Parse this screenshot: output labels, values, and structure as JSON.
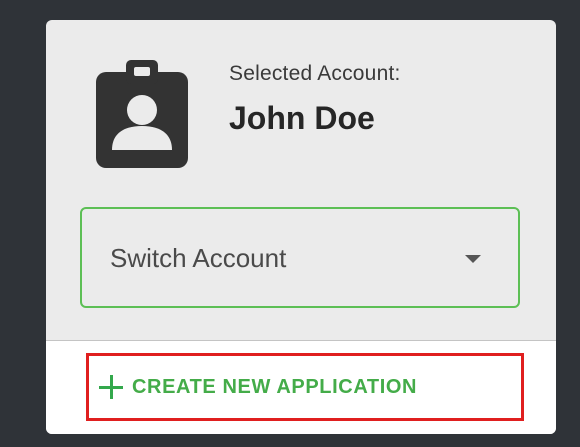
{
  "account": {
    "selected_label": "Selected Account:",
    "name": "John Doe",
    "icon": "account-badge-icon"
  },
  "switch_select": {
    "label": "Switch Account",
    "icon": "caret-down-icon"
  },
  "create_button": {
    "label": "CREATE NEW APPLICATION",
    "icon": "plus-icon"
  },
  "colors": {
    "background": "#2f3338",
    "card": "#ebebeb",
    "accent_green": "#44ac49",
    "select_border": "#5cbf55",
    "highlight_red": "#e01f1f"
  }
}
